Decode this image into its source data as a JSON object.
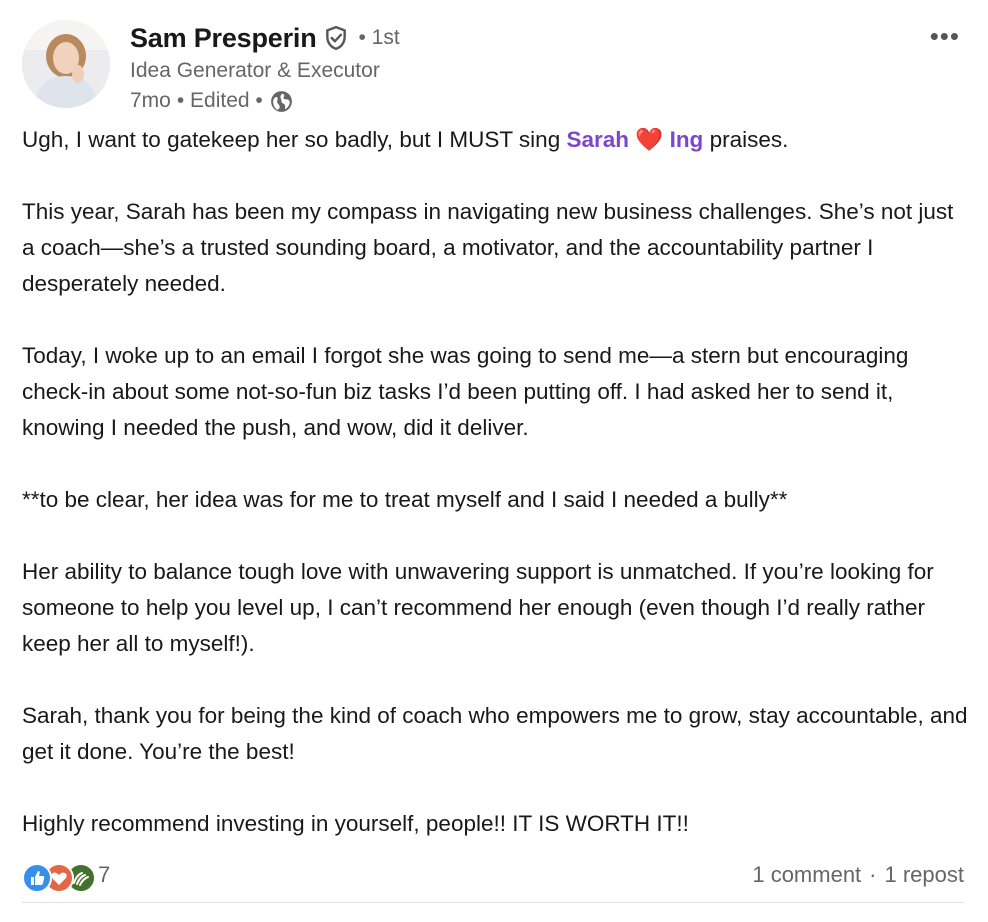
{
  "author": {
    "name": "Sam Presperin",
    "degree": "• 1st",
    "headline": "Idea Generator & Executor",
    "time": "7mo",
    "edited": "• Edited •"
  },
  "post": {
    "intro_before": "Ugh, I want to gatekeep her so badly, but I MUST sing ",
    "mention_first": "Sarah",
    "mention_emoji": "❤️",
    "mention_last": "Ing",
    "intro_after": " praises.",
    "paragraphs": [
      "This year, Sarah has been my compass in navigating new business challenges. She’s not just a coach—she’s a trusted sounding board, a motivator, and the accountability partner I desperately needed.",
      "Today, I woke up to an email I forgot she was going to send me—a stern but encouraging check-in about some not-so-fun biz tasks I’d been putting off. I had asked her to send it, knowing I needed the push, and wow, did it deliver.",
      "**to be clear, her idea was for me to treat myself and I said I needed a bully**",
      "Her ability to balance tough love with unwavering support is unmatched. If you’re looking for someone to help you level up, I can’t recommend her enough (even though I’d really rather keep her all to myself!).",
      "Sarah, thank you for being the kind of coach who empowers me to grow, stay accountable, and get it done. You’re the best!",
      "Highly recommend investing in yourself, people!! IT IS WORTH IT!!"
    ]
  },
  "social": {
    "reaction_count": "7",
    "comments": "1 comment",
    "separator": "·",
    "reposts": "1 repost"
  },
  "icons": {
    "verified": "shield-check-icon",
    "globe": "globe-icon",
    "more": "more-horizontal-icon",
    "reactions": [
      "like-icon",
      "love-icon",
      "support-icon"
    ]
  },
  "colors": {
    "mention": "#7c47c9",
    "secondary_text": "#666666",
    "like": "#378fe9",
    "love": "#e06847",
    "support": "#44712e"
  }
}
